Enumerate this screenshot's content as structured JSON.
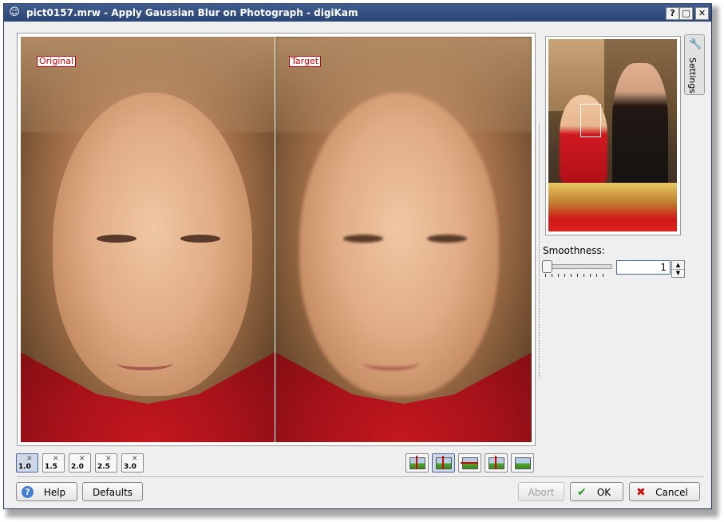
{
  "window": {
    "title": "pict0157.mrw - Apply Gaussian Blur on Photograph - digiKam",
    "app_icon": "digikam-icon",
    "controls": [
      "?",
      "□",
      "✕"
    ]
  },
  "preview": {
    "left_label": "Original",
    "right_label": "Target"
  },
  "zoom_buttons": [
    {
      "label": "1.0",
      "icon": "zoom-icon",
      "active": true
    },
    {
      "label": "1.5",
      "icon": "zoom-icon",
      "active": false
    },
    {
      "label": "2.0",
      "icon": "zoom-icon",
      "active": false
    },
    {
      "label": "2.5",
      "icon": "zoom-icon",
      "active": false
    },
    {
      "label": "3.0",
      "icon": "zoom-icon",
      "active": false
    }
  ],
  "split_modes": [
    {
      "name": "split-vertical-duplicate",
      "icon": "split-duplicate-vertical-icon",
      "active": false
    },
    {
      "name": "split-vertical-card",
      "icon": "split-card-vertical-icon",
      "active": true
    },
    {
      "name": "split-horizontal-card",
      "icon": "split-card-horizontal-icon",
      "active": false
    },
    {
      "name": "split-vertical",
      "icon": "split-vertical-icon",
      "active": false
    },
    {
      "name": "preview-target",
      "icon": "preview-target-icon",
      "active": false
    }
  ],
  "settings": {
    "tab_label": "Settings",
    "tab_icon": "wrench-icon",
    "smoothness_label": "Smoothness:",
    "smoothness_value": "1"
  },
  "buttons": {
    "help": "Help",
    "defaults": "Defaults",
    "abort": "Abort",
    "ok": "OK",
    "cancel": "Cancel"
  },
  "colors": {
    "titlebar": "#2f4c80",
    "label_red": "#cc0000",
    "ok_check": "#2a9a2a",
    "cancel_x": "#cc1010"
  }
}
